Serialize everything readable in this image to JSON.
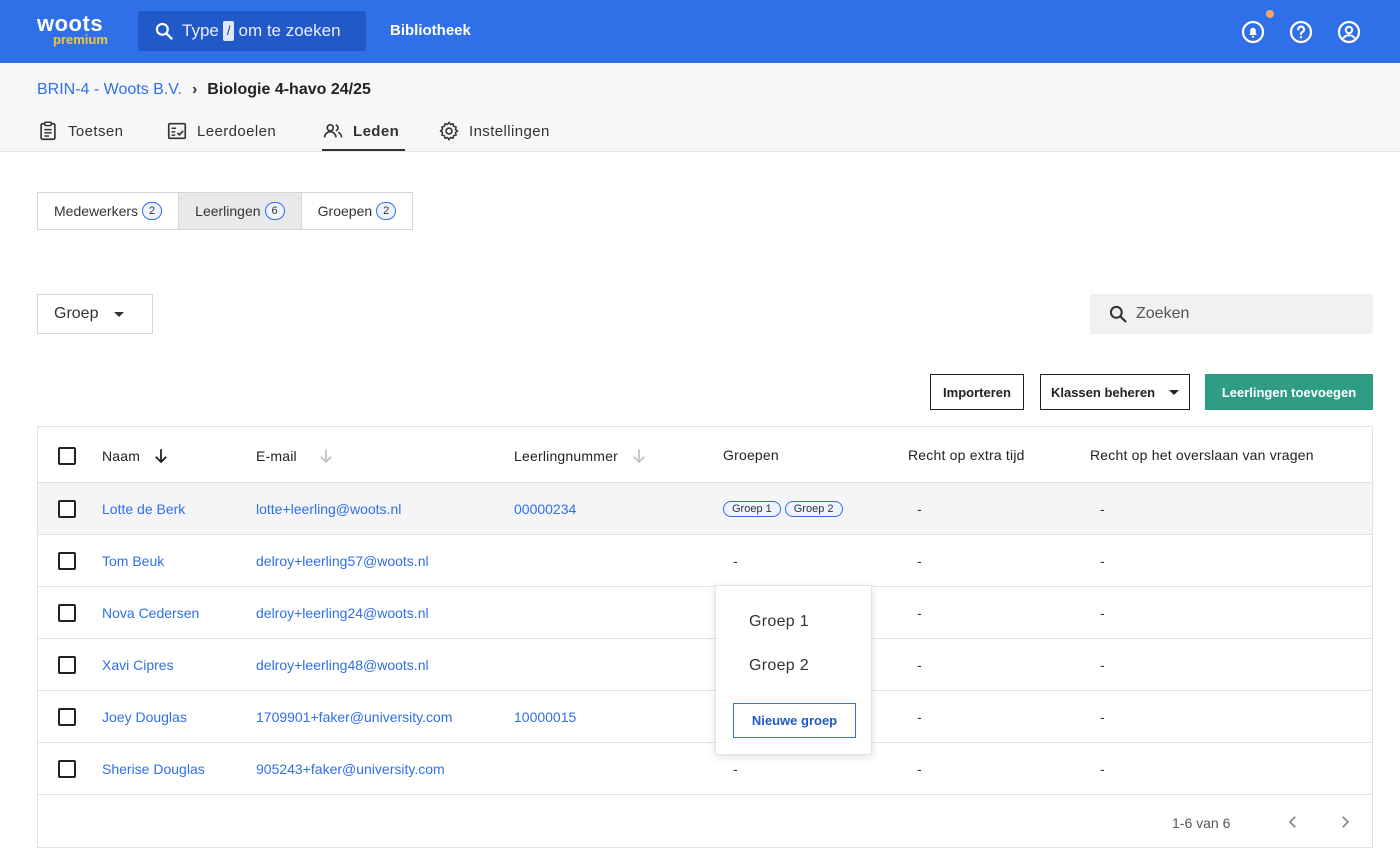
{
  "topbar": {
    "logo_main": "woots",
    "logo_sub": "premium",
    "search_prefix": "Type",
    "search_key": "/",
    "search_suffix": "om te zoeken",
    "nav_library": "Bibliotheek"
  },
  "breadcrumb": {
    "parent": "BRIN-4 - Woots B.V.",
    "separator": "›",
    "current": "Biologie 4-havo 24/25"
  },
  "tabs": [
    {
      "label": "Toetsen",
      "icon": "clipboard-icon"
    },
    {
      "label": "Leerdoelen",
      "icon": "checklist-icon"
    },
    {
      "label": "Leden",
      "icon": "users-icon",
      "active": true
    },
    {
      "label": "Instellingen",
      "icon": "gear-icon"
    }
  ],
  "segments": [
    {
      "label": "Medewerkers",
      "count": "2"
    },
    {
      "label": "Leerlingen",
      "count": "6",
      "active": true
    },
    {
      "label": "Groepen",
      "count": "2"
    }
  ],
  "filter": {
    "label": "Groep"
  },
  "search": {
    "placeholder": "Zoeken"
  },
  "actions": {
    "import": "Importeren",
    "manage": "Klassen beheren",
    "add": "Leerlingen toevoegen"
  },
  "table": {
    "headers": [
      "Naam",
      "E-mail",
      "Leerlingnummer",
      "Groepen",
      "Recht op extra tijd",
      "Recht op het overslaan van vragen"
    ],
    "rows": [
      {
        "name": "Lotte de Berk",
        "email": "lotte+leerling@woots.nl",
        "number": "00000234",
        "groups": [
          "Groep 1",
          "Groep 2"
        ],
        "extra": "-",
        "skip": "-"
      },
      {
        "name": "Tom Beuk",
        "email": "delroy+leerling57@woots.nl",
        "number": "",
        "groups": [],
        "groups_text": "-",
        "extra": "-",
        "skip": "-"
      },
      {
        "name": "Nova Cedersen",
        "email": "delroy+leerling24@woots.nl",
        "number": "",
        "groups": [],
        "extra": "-",
        "skip": "-"
      },
      {
        "name": "Xavi Cipres",
        "email": "delroy+leerling48@woots.nl",
        "number": "",
        "groups": [],
        "extra": "-",
        "skip": "-"
      },
      {
        "name": "Joey Douglas",
        "email": "1709901+faker@university.com",
        "number": "10000015",
        "groups": [],
        "extra": "-",
        "skip": "-"
      },
      {
        "name": "Sherise Douglas",
        "email": "905243+faker@university.com",
        "number": "",
        "groups": [],
        "groups_text": "-",
        "extra": "-",
        "skip": "-"
      }
    ],
    "pager": "1-6 van 6"
  },
  "popover": {
    "items": [
      "Groep 1",
      "Groep 2"
    ],
    "new_button": "Nieuwe groep"
  },
  "colors": {
    "brand": "#2f6fe8",
    "primary_button": "#2f9c84",
    "logo_accent": "#f5c542"
  }
}
